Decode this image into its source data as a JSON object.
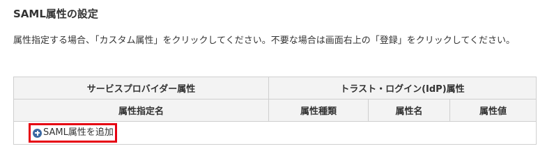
{
  "section": {
    "title": "SAML属性の設定",
    "description": "属性指定する場合、「カスタム属性」をクリックしてください。不要な場合は画面右上の「登録」をクリックしてください。"
  },
  "table": {
    "group_headers": {
      "service_provider": "サービスプロバイダー属性",
      "trust_login": "トラスト・ログイン(IdP)属性"
    },
    "columns": {
      "attribute_spec_name": "属性指定名",
      "attribute_type": "属性種類",
      "attribute_name": "属性名",
      "attribute_value": "属性値"
    },
    "add_button": {
      "icon": "plus-circle-icon",
      "label": "SAML属性を追加"
    }
  },
  "colors": {
    "highlight_border": "#e60012",
    "icon_blue": "#3b69a3",
    "header_bg": "#f3f3f3",
    "border": "#cfcfcf",
    "text": "#333333"
  }
}
